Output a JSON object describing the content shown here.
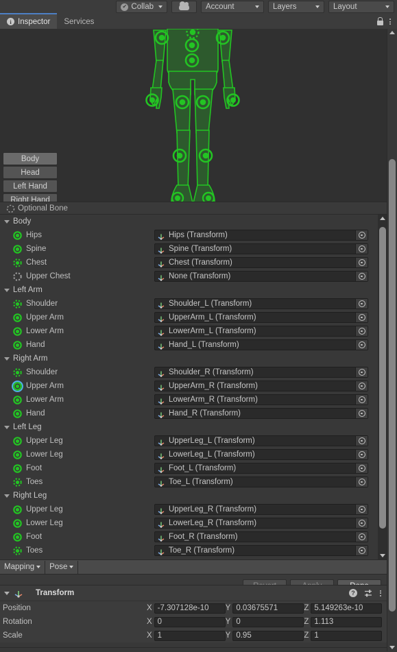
{
  "toolbar": {
    "collab_label": "Collab",
    "collab_icon": "check-circle-icon",
    "cloud_icon": "cloud-icon",
    "account_label": "Account",
    "layers_label": "Layers",
    "layout_label": "Layout"
  },
  "tabs": {
    "inspector_label": "Inspector",
    "services_label": "Services",
    "lock_icon": "lock-icon",
    "menu_icon": "kebab-menu-icon"
  },
  "avatar": {
    "categories": [
      {
        "label": "Body",
        "selected": true
      },
      {
        "label": "Head",
        "selected": false
      },
      {
        "label": "Left Hand",
        "selected": false
      },
      {
        "label": "Right Hand",
        "selected": false
      }
    ],
    "optional_bone_label": "Optional Bone"
  },
  "bone_groups": [
    {
      "name": "Body",
      "bones": [
        {
          "label": "Hips",
          "state": "required",
          "value": "Hips (Transform)"
        },
        {
          "label": "Spine",
          "state": "required",
          "value": "Spine (Transform)"
        },
        {
          "label": "Chest",
          "state": "optional",
          "value": "Chest (Transform)"
        },
        {
          "label": "Upper Chest",
          "state": "empty",
          "value": "None (Transform)"
        }
      ]
    },
    {
      "name": "Left Arm",
      "bones": [
        {
          "label": "Shoulder",
          "state": "optional",
          "value": "Shoulder_L (Transform)"
        },
        {
          "label": "Upper Arm",
          "state": "required",
          "value": "UpperArm_L (Transform)"
        },
        {
          "label": "Lower Arm",
          "state": "required",
          "value": "LowerArm_L (Transform)"
        },
        {
          "label": "Hand",
          "state": "required",
          "value": "Hand_L (Transform)"
        }
      ]
    },
    {
      "name": "Right Arm",
      "bones": [
        {
          "label": "Shoulder",
          "state": "optional",
          "value": "Shoulder_R (Transform)"
        },
        {
          "label": "Upper Arm",
          "state": "required",
          "value": "UpperArm_R (Transform)",
          "selected": true
        },
        {
          "label": "Lower Arm",
          "state": "required",
          "value": "LowerArm_R (Transform)"
        },
        {
          "label": "Hand",
          "state": "required",
          "value": "Hand_R (Transform)"
        }
      ]
    },
    {
      "name": "Left Leg",
      "bones": [
        {
          "label": "Upper Leg",
          "state": "required",
          "value": "UpperLeg_L (Transform)"
        },
        {
          "label": "Lower Leg",
          "state": "required",
          "value": "LowerLeg_L (Transform)"
        },
        {
          "label": "Foot",
          "state": "required",
          "value": "Foot_L (Transform)"
        },
        {
          "label": "Toes",
          "state": "optional",
          "value": "Toe_L (Transform)"
        }
      ]
    },
    {
      "name": "Right Leg",
      "bones": [
        {
          "label": "Upper Leg",
          "state": "required",
          "value": "UpperLeg_R (Transform)"
        },
        {
          "label": "Lower Leg",
          "state": "required",
          "value": "LowerLeg_R (Transform)"
        },
        {
          "label": "Foot",
          "state": "required",
          "value": "Foot_R (Transform)"
        },
        {
          "label": "Toes",
          "state": "optional",
          "value": "Toe_R (Transform)"
        }
      ]
    }
  ],
  "mapping_bar": {
    "mapping_label": "Mapping",
    "pose_label": "Pose"
  },
  "actions": {
    "revert_label": "Revert",
    "revert_enabled": false,
    "apply_label": "Apply",
    "apply_enabled": false,
    "done_label": "Done",
    "done_enabled": true
  },
  "transform": {
    "title": "Transform",
    "help_icon": "help-icon",
    "preset_icon": "preset-settings-icon",
    "menu_icon": "kebab-menu-icon",
    "axis_x": "X",
    "axis_y": "Y",
    "axis_z": "Z",
    "rows": [
      {
        "label": "Position",
        "x": "-7.307128e-10",
        "y": "0.03675571",
        "z": "5.149263e-10"
      },
      {
        "label": "Rotation",
        "x": "0",
        "y": "0",
        "z": "1.113"
      },
      {
        "label": "Scale",
        "x": "1",
        "y": "0.95",
        "z": "1"
      }
    ]
  },
  "colors": {
    "bone_green": "#23c423",
    "selection_blue": "#4fb3e8",
    "accent_tab": "#4d7fc4"
  }
}
